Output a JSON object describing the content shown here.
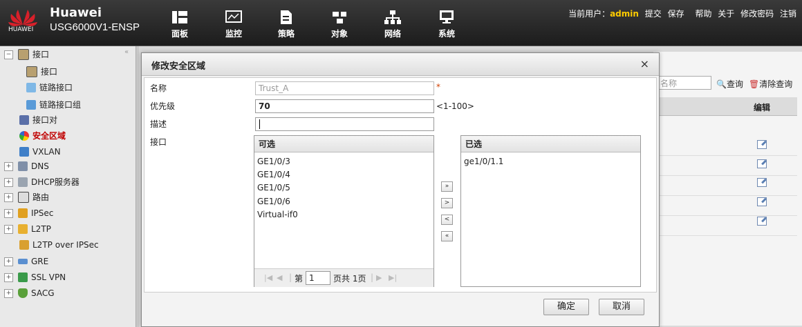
{
  "header": {
    "brand": "Huawei",
    "model": "USG6000V1-ENSP",
    "logo_text": "HUAWEI",
    "nav": [
      {
        "label": "面板",
        "icon": "dashboard-icon"
      },
      {
        "label": "监控",
        "icon": "monitor-icon"
      },
      {
        "label": "策略",
        "icon": "policy-icon"
      },
      {
        "label": "对象",
        "icon": "object-icon"
      },
      {
        "label": "网络",
        "icon": "network-icon"
      },
      {
        "label": "系统",
        "icon": "system-icon"
      }
    ],
    "current_user_label": "当前用户：",
    "user": "admin",
    "links": [
      "提交",
      "保存",
      "帮助",
      "关于",
      "修改密码",
      "注销"
    ]
  },
  "sidebar": {
    "items": [
      {
        "label": "接口",
        "toggle": "−"
      },
      {
        "label": "接口"
      },
      {
        "label": "链路接口"
      },
      {
        "label": "链路接口组"
      },
      {
        "label": "接口对"
      },
      {
        "label": "安全区域"
      },
      {
        "label": "VXLAN"
      },
      {
        "label": "DNS",
        "toggle": "+"
      },
      {
        "label": "DHCP服务器",
        "toggle": "+"
      },
      {
        "label": "路由",
        "toggle": "+"
      },
      {
        "label": "IPSec",
        "toggle": "+"
      },
      {
        "label": "L2TP",
        "toggle": "+"
      },
      {
        "label": "L2TP over IPSec"
      },
      {
        "label": "GRE",
        "toggle": "+"
      },
      {
        "label": "SSL VPN",
        "toggle": "+"
      },
      {
        "label": "SACG",
        "toggle": "+"
      }
    ]
  },
  "background": {
    "search_placeholder": "名称",
    "query_label": "查询",
    "clear_label": "清除查询",
    "edit_header": "编辑"
  },
  "dialog": {
    "title": "修改安全区域",
    "close": "×",
    "name_label": "名称",
    "name_value": "Trust_A",
    "required_mark": "*",
    "priority_label": "优先级",
    "priority_value": "70",
    "priority_hint": "<1-100>",
    "desc_label": "描述",
    "desc_value": "",
    "iface_label": "接口",
    "available_header": "可选",
    "available": [
      "GE1/0/3",
      "GE1/0/4",
      "GE1/0/5",
      "GE1/0/6",
      "Virtual-if0"
    ],
    "selected_header": "已选",
    "selected": [
      "ge1/0/1.1"
    ],
    "pager": {
      "page_prefix": "第",
      "page_value": "1",
      "page_suffix": "页共 1页"
    },
    "move_buttons": [
      "»",
      ">",
      "<",
      "«"
    ],
    "ok": "确定",
    "cancel": "取消"
  }
}
